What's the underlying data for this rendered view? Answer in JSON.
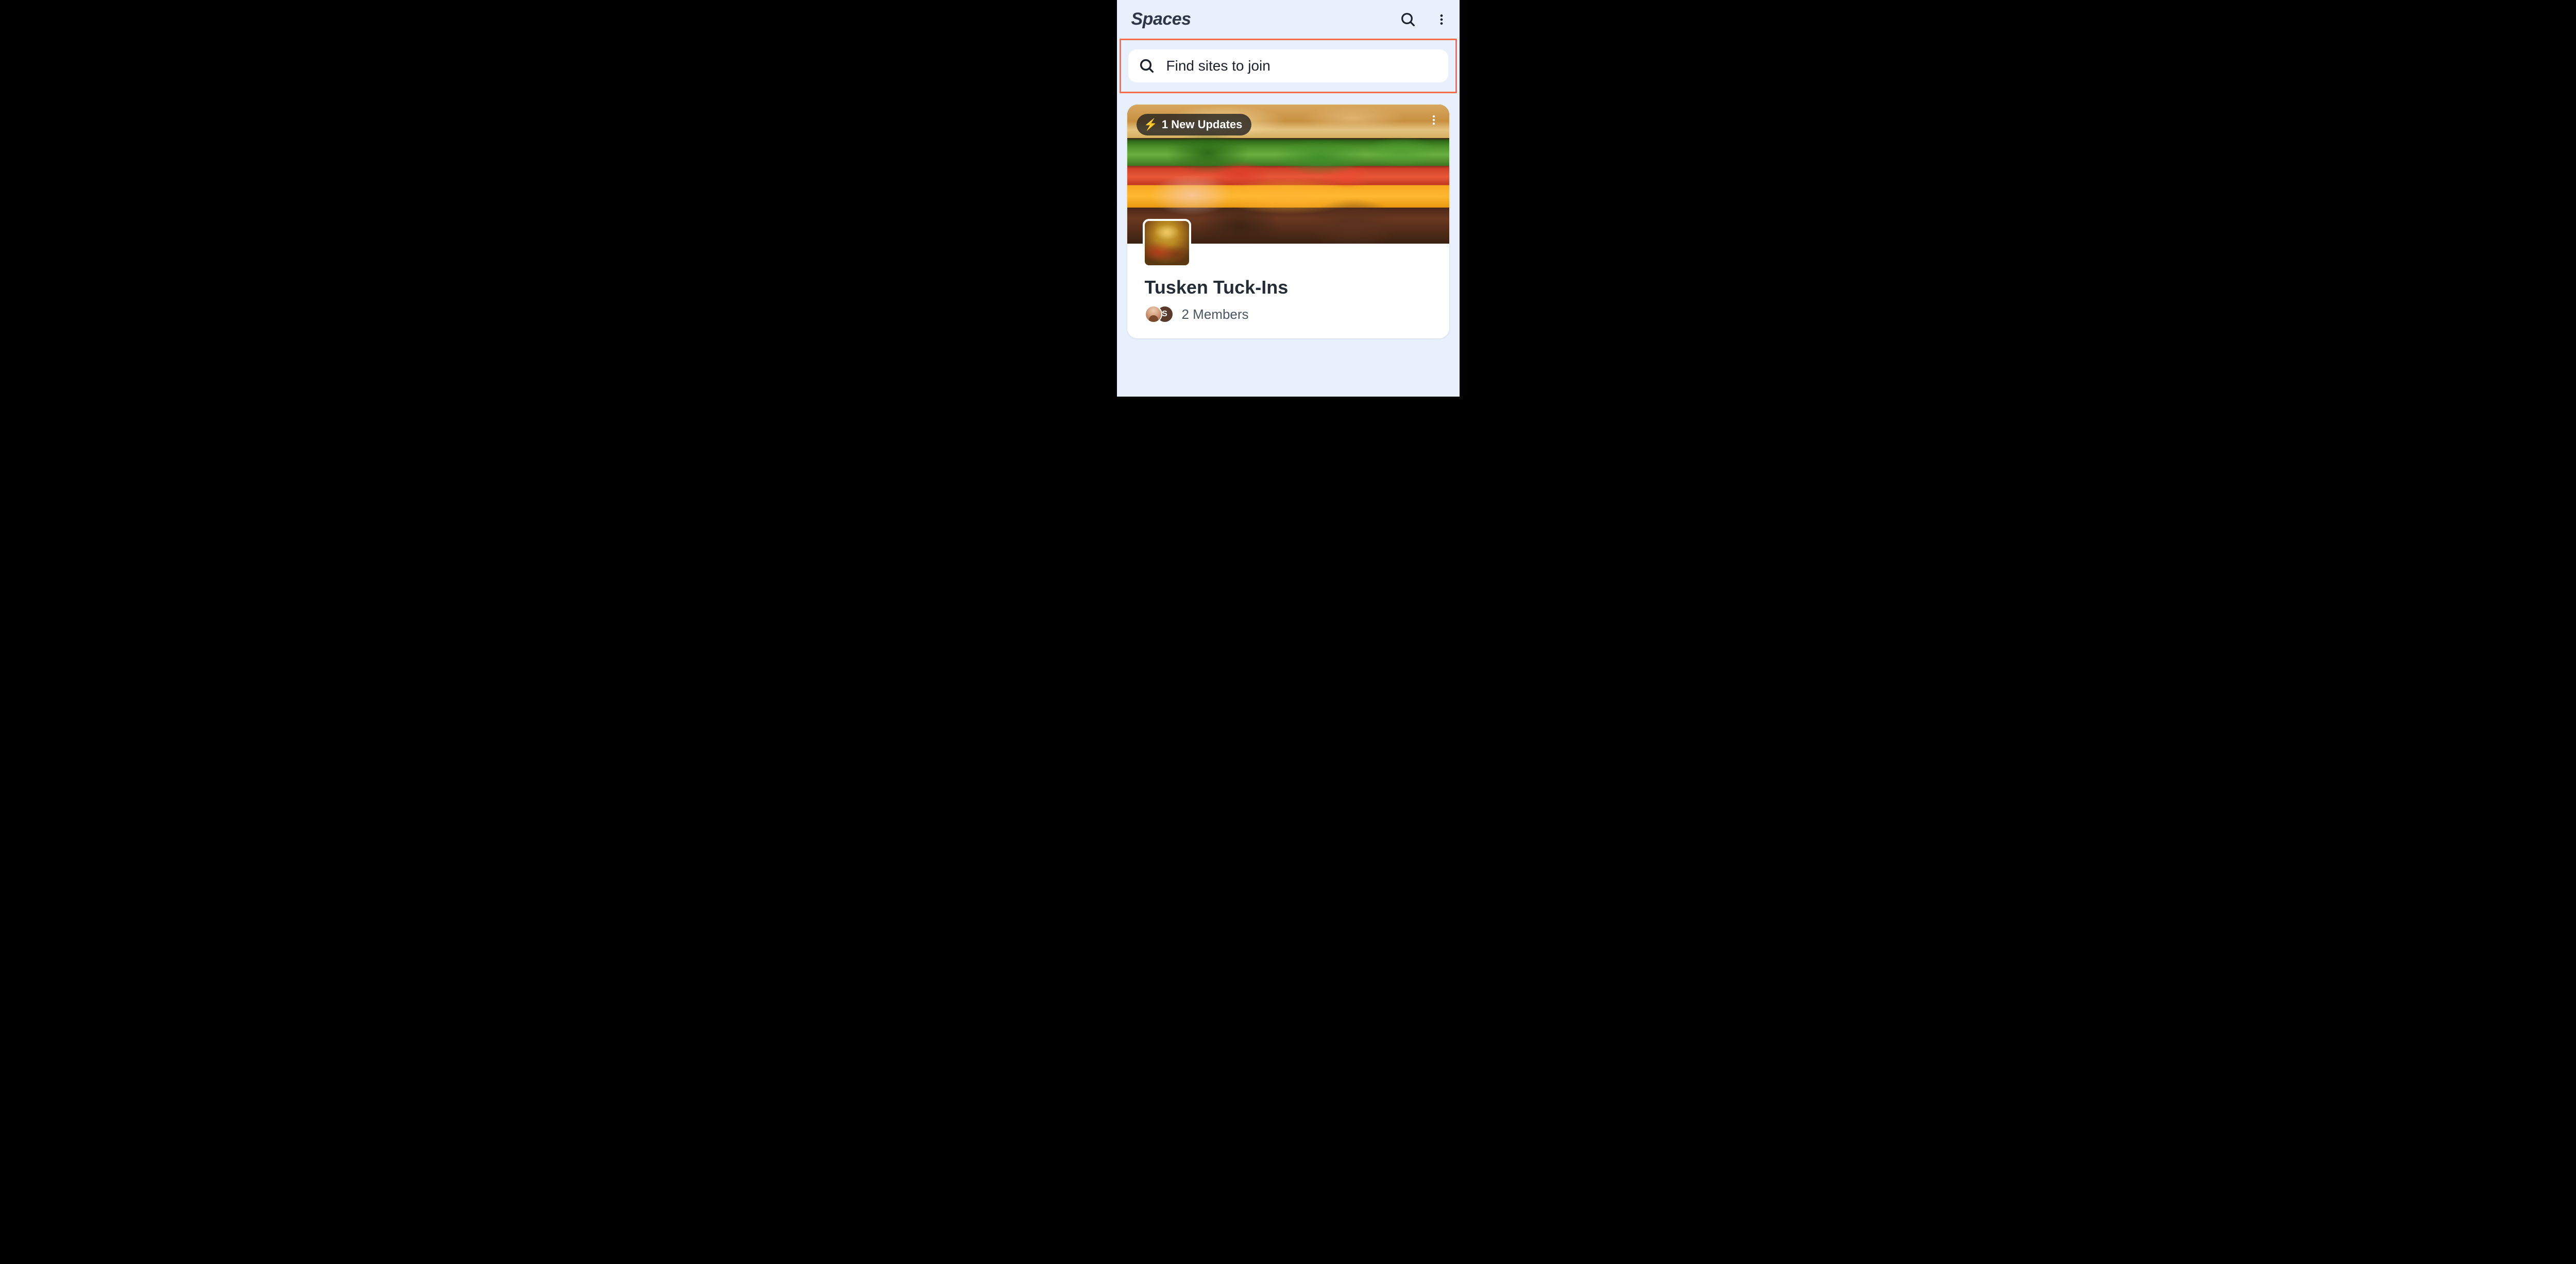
{
  "header": {
    "title": "Spaces"
  },
  "search": {
    "placeholder": "Find sites to join"
  },
  "card": {
    "updates_badge": "1 New Updates",
    "title": "Tusken Tuck-Ins",
    "members_text": "2 Members",
    "avatar2_initial": "S"
  }
}
